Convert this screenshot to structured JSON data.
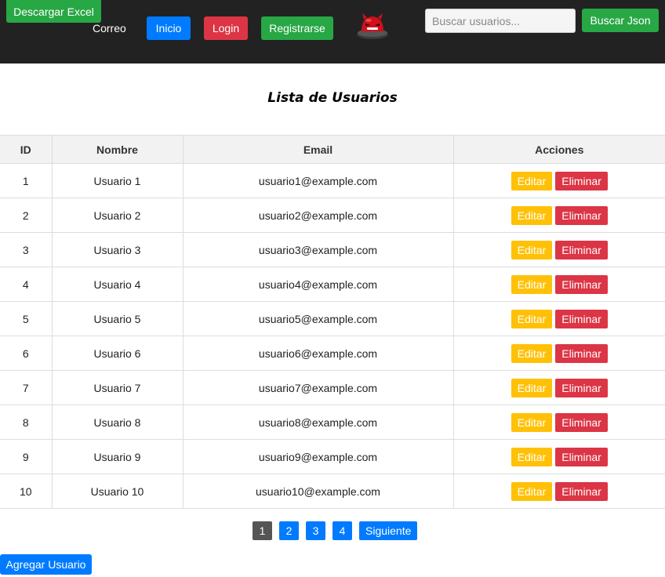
{
  "nav": {
    "excel_label": "Descargar Excel",
    "correo_label": "Correo",
    "inicio_label": "Inicio",
    "login_label": "Login",
    "registrarse_label": "Registrarse",
    "search_placeholder": "Buscar usuarios...",
    "search_json_label": "Buscar Json",
    "mascot_icon": "red-devil-mascot-icon"
  },
  "page_title": "Lista de Usuarios",
  "table": {
    "headers": [
      "ID",
      "Nombre",
      "Email",
      "Acciones"
    ],
    "rows": [
      {
        "id": "1",
        "name": "Usuario 1",
        "email": "usuario1@example.com"
      },
      {
        "id": "2",
        "name": "Usuario 2",
        "email": "usuario2@example.com"
      },
      {
        "id": "3",
        "name": "Usuario 3",
        "email": "usuario3@example.com"
      },
      {
        "id": "4",
        "name": "Usuario 4",
        "email": "usuario4@example.com"
      },
      {
        "id": "5",
        "name": "Usuario 5",
        "email": "usuario5@example.com"
      },
      {
        "id": "6",
        "name": "Usuario 6",
        "email": "usuario6@example.com"
      },
      {
        "id": "7",
        "name": "Usuario 7",
        "email": "usuario7@example.com"
      },
      {
        "id": "8",
        "name": "Usuario 8",
        "email": "usuario8@example.com"
      },
      {
        "id": "9",
        "name": "Usuario 9",
        "email": "usuario9@example.com"
      },
      {
        "id": "10",
        "name": "Usuario 10",
        "email": "usuario10@example.com"
      }
    ],
    "edit_label": "Editar",
    "delete_label": "Eliminar"
  },
  "pagination": {
    "pages": [
      "1",
      "2",
      "3",
      "4"
    ],
    "active_page": "1",
    "next_label": "Siguiente"
  },
  "add_user_label": "Agregar Usuario",
  "colors": {
    "navbar": "#222222",
    "green": "#28a745",
    "blue": "#007bff",
    "red": "#dc3545",
    "yellow": "#ffc107",
    "active_page": "#555555"
  }
}
